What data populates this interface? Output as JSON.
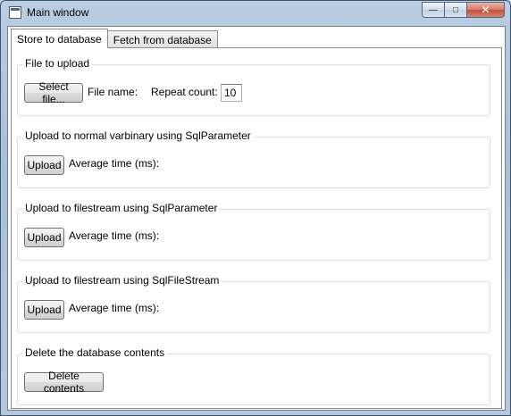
{
  "window": {
    "title": "Main window",
    "minimize_glyph": "—",
    "maximize_glyph": "□",
    "close_glyph": "✕"
  },
  "tabs": [
    {
      "label": "Store to database",
      "selected": true
    },
    {
      "label": "Fetch from database",
      "selected": false
    }
  ],
  "file_group": {
    "header": "File to upload",
    "select_button": "Select file...",
    "file_name_label": "File name:",
    "repeat_count_label": "Repeat count:",
    "repeat_count_value": "10"
  },
  "varbinary_group": {
    "header": "Upload to normal varbinary using SqlParameter",
    "upload_button": "Upload",
    "avg_time_label": "Average time (ms):"
  },
  "filestream_param_group": {
    "header": "Upload to filestream using SqlParameter",
    "upload_button": "Upload",
    "avg_time_label": "Average time (ms):"
  },
  "filestream_sfs_group": {
    "header": "Upload to filestream using SqlFileStream",
    "upload_button": "Upload",
    "avg_time_label": "Average time (ms):"
  },
  "delete_group": {
    "header": "Delete the database contents",
    "delete_button": "Delete contents"
  }
}
